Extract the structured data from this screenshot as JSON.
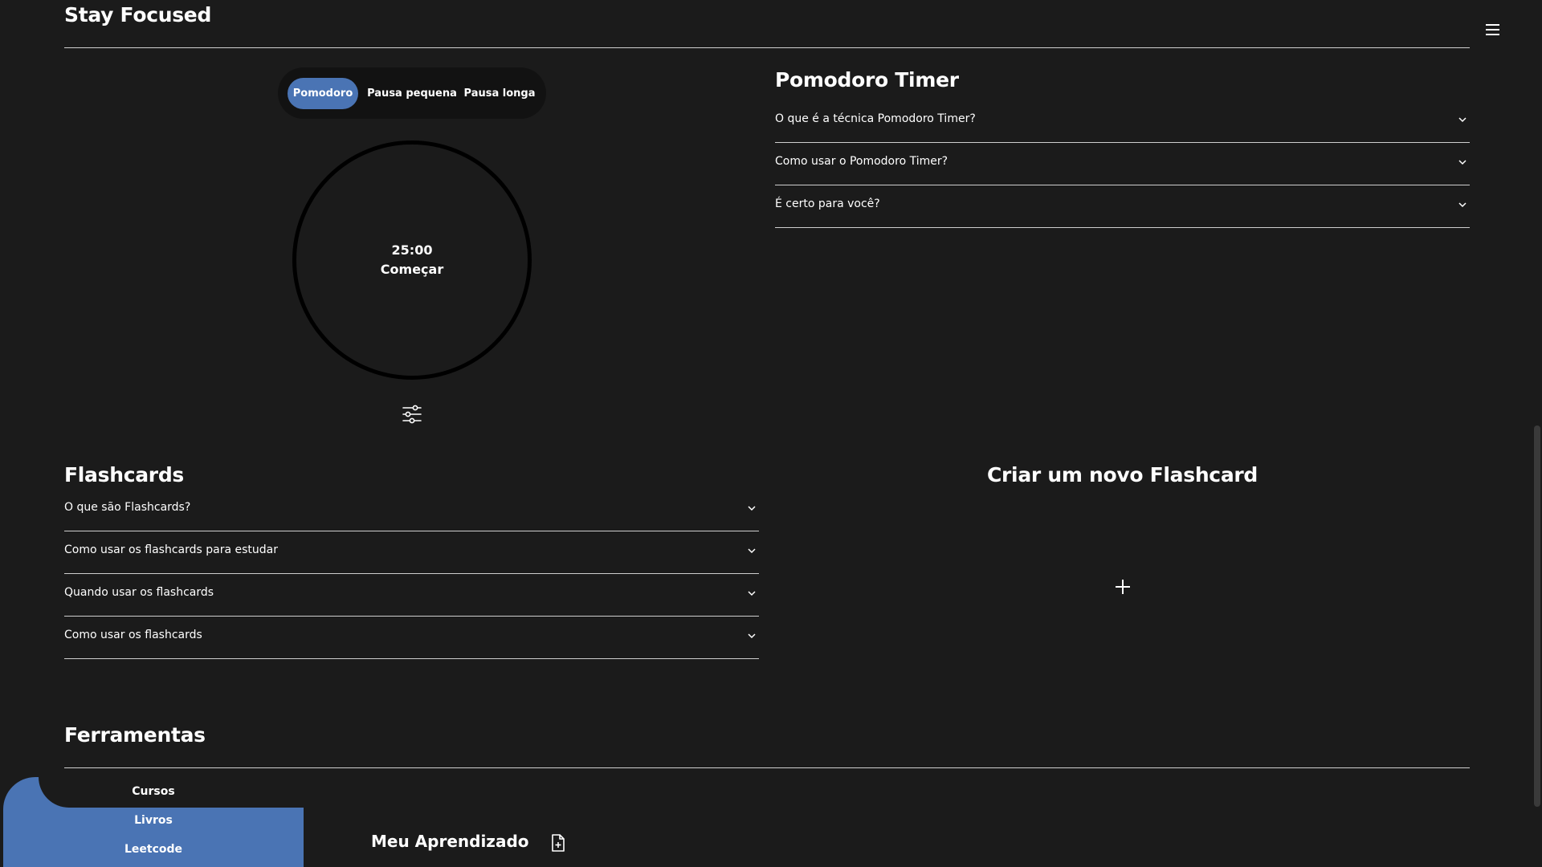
{
  "header": {
    "site_title": "Stay Focused",
    "menu_icon": "hamburger-menu-icon"
  },
  "timer": {
    "tabs": [
      {
        "label": "Pomodoro",
        "active": true
      },
      {
        "label": "Pausa pequena",
        "active": false
      },
      {
        "label": "Pausa longa",
        "active": false
      }
    ],
    "time": "25:00",
    "start_label": "Começar",
    "settings_icon": "sliders-icon",
    "accent_color": "#4a74b4"
  },
  "pomodoro_info": {
    "title": "Pomodoro Timer",
    "items": [
      {
        "label": "O que é a técnica Pomodoro Timer?"
      },
      {
        "label": "Como usar o Pomodoro Timer?"
      },
      {
        "label": "É certo para você?"
      }
    ]
  },
  "flashcards": {
    "title": "Flashcards",
    "items": [
      {
        "label": "O que são Flashcards?"
      },
      {
        "label": "Como usar os flashcards para estudar"
      },
      {
        "label": "Quando usar os flashcards"
      },
      {
        "label": "Como usar os flashcards"
      }
    ],
    "create_title": "Criar um novo Flashcard",
    "add_icon": "plus-icon"
  },
  "tools": {
    "title": "Ferramentas",
    "side_links": [
      {
        "label": "Cursos"
      },
      {
        "label": "Livros"
      },
      {
        "label": "Leetcode"
      }
    ],
    "learning_title": "Meu Aprendizado",
    "learning_icon": "file-plus-icon"
  }
}
